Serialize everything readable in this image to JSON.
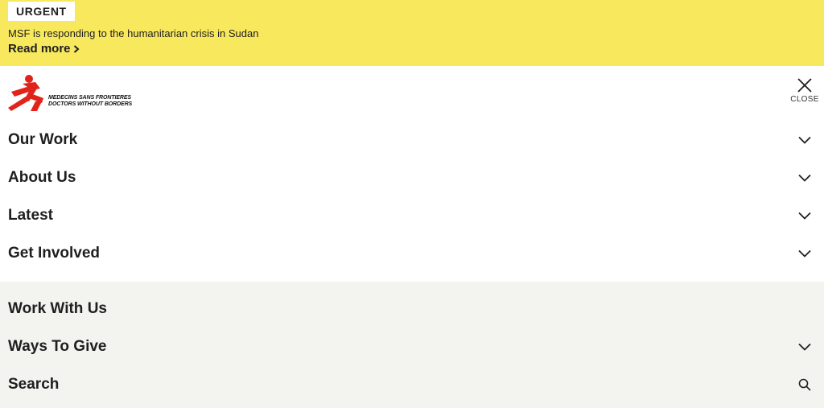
{
  "banner": {
    "badge": "URGENT",
    "text": "MSF is responding to the humanitarian crisis in Sudan",
    "link": "Read more"
  },
  "header": {
    "logo_line1": "MEDECINS SANS FRONTIERES",
    "logo_line2": "DOCTORS WITHOUT BORDERS",
    "close_label": "CLOSE"
  },
  "nav": {
    "primary": [
      {
        "label": "Our Work",
        "icon": "chevron-down-icon"
      },
      {
        "label": "About Us",
        "icon": "chevron-down-icon"
      },
      {
        "label": "Latest",
        "icon": "chevron-down-icon"
      },
      {
        "label": "Get Involved",
        "icon": "chevron-down-icon"
      }
    ],
    "secondary": [
      {
        "label": "Work With Us",
        "icon": ""
      },
      {
        "label": "Ways To Give",
        "icon": "chevron-down-icon"
      },
      {
        "label": "Search",
        "icon": "search-icon"
      }
    ]
  },
  "colors": {
    "banner_bg": "#f8e85e",
    "brand_red": "#e2231a",
    "secondary_bg": "#f3f3f0"
  }
}
